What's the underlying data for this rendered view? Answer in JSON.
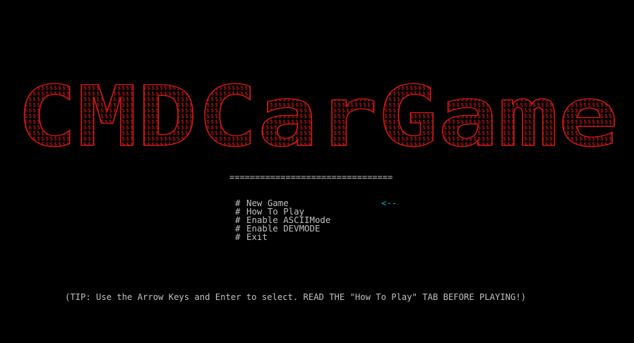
{
  "game": {
    "title_art_text": "CMDCarGame",
    "title_art_fill_char": "$",
    "colors": {
      "background": "#000000",
      "title_red": "#d01818",
      "menu_text": "#c0c0c0",
      "selector_cyan": "#00b8c8"
    }
  },
  "menu": {
    "separator": "================================",
    "marker": "#",
    "items": [
      {
        "label": "New Game"
      },
      {
        "label": "How To Play"
      },
      {
        "label": "Enable ASCIIMode"
      },
      {
        "label": "Enable DEVMODE"
      },
      {
        "label": "Exit"
      }
    ],
    "selected_index": 0,
    "selector": "<--"
  },
  "tip": "(TIP: Use the Arrow Keys and Enter to select. READ THE \"How To Play\" TAB BEFORE PLAYING!)"
}
